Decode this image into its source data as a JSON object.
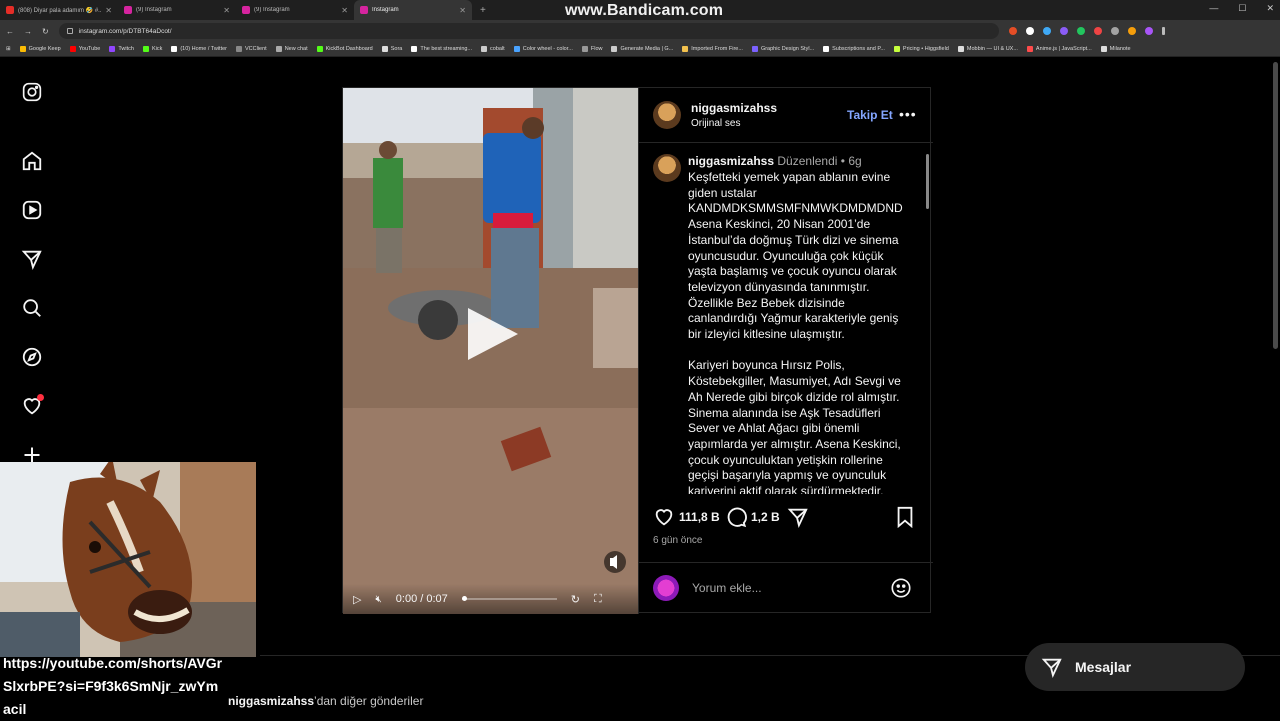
{
  "browser": {
    "tabs": [
      {
        "title": "(808) Diyar pala adamım 🤣 #...",
        "fav": "#e52d27",
        "active": false
      },
      {
        "title": "(9) Instagram",
        "fav": "#d6249f",
        "active": false
      },
      {
        "title": "(9) Instagram",
        "fav": "#d6249f",
        "active": false
      },
      {
        "title": "Instagram",
        "fav": "#d6249f",
        "active": true
      }
    ],
    "new_tab": "+",
    "url": "instagram.com/p/DTBT64aDcot/",
    "watermark": "www.Bandicam.com",
    "bookmarks": [
      {
        "label": "Google Keep",
        "color": "#fbbc04"
      },
      {
        "label": "YouTube",
        "color": "#ff0000"
      },
      {
        "label": "Twitch",
        "color": "#9146ff"
      },
      {
        "label": "Kick",
        "color": "#53fc18"
      },
      {
        "label": "(10) Home / Twitter",
        "color": "#ffffff"
      },
      {
        "label": "VCClient",
        "color": "#888888"
      },
      {
        "label": "New chat",
        "color": "#aaaaaa"
      },
      {
        "label": "KickBot Dashboard",
        "color": "#53fc18"
      },
      {
        "label": "Sora",
        "color": "#dddddd"
      },
      {
        "label": "The best streaming...",
        "color": "#ffffff"
      },
      {
        "label": "cobalt",
        "color": "#cccccc"
      },
      {
        "label": "Color wheel - color...",
        "color": "#4aa3ff"
      },
      {
        "label": "Flow",
        "color": "#999999"
      },
      {
        "label": "Generate Media | G...",
        "color": "#cccccc"
      },
      {
        "label": "Imported From Fire...",
        "color": "#f2c14e"
      },
      {
        "label": "Graphic Design Styl...",
        "color": "#7b61ff"
      },
      {
        "label": "Subscriptions and P...",
        "color": "#ffffff"
      },
      {
        "label": "Pricing • Higgsfield",
        "color": "#c6ff3d"
      },
      {
        "label": "Mobbin — UI & UX...",
        "color": "#dddddd"
      },
      {
        "label": "Anime.js | JavaScript...",
        "color": "#ff4b4b"
      },
      {
        "label": "Milanote",
        "color": "#dddddd"
      }
    ]
  },
  "post": {
    "username": "niggasmizahss",
    "audio": "Orijinal ses",
    "follow_label": "Takip Et",
    "more_label": "•••",
    "caption_user": "niggasmizahss",
    "edited": "Düzenlendi",
    "age": "6g",
    "caption": "Keşfetteki yemek yapan ablanın evine\ngiden ustalar\nKANDMDKSMMSMFNMWKDMDMDND\nAsena Keskinci, 20 Nisan 2001’de\nİstanbul’da doğmuş Türk dizi ve sinema\noyuncusudur. Oyunculuğa çok küçük\nyaşta başlamış ve çocuk oyuncu olarak\ntelevizyon dünyasında tanınmıştır.\nÖzellikle Bez Bebek dizisinde\ncanlandırdığı Yağmur karakteriyle geniş\nbir izleyici kitlesine ulaşmıştır.\n\nKariyeri boyunca Hırsız Polis,\nKöstebekgiller, Masumiyet, Adı Sevgi ve\nAh Nerede gibi birçok dizide rol almıştır.\nSinema alanında ise Aşk Tesadüfleri\nSever ve Ahlat Ağacı gibi önemli\nyapımlarda yer almıştır. Asena Keskinci,\nçocuk oyunculuktan yetişkin rollerine\ngeçişi başarıyla yapmış ve oyunculuk\nkariyerini aktif olarak sürdürmektedir.",
    "likes": "111,8 B",
    "comments": "1,2 B",
    "posted": "6 gün önce",
    "comment_placeholder": "Yorum ekle...",
    "video_time": "0:00 / 0:07",
    "video_progress": 0.0
  },
  "page": {
    "more_from_user": "niggasmizahss",
    "more_from_suffix": "’dan diğer gönderiler",
    "messages_label": "Mesajlar"
  },
  "overlay": {
    "text": "https://youtube.com/shorts/AVGr\nSlxrbPE?si=F9f3k6SmNjr_zwYm\nacil"
  },
  "colors": {
    "accent_link": "#84a6ff",
    "notification_dot": "#ff3040",
    "background": "#000000"
  }
}
